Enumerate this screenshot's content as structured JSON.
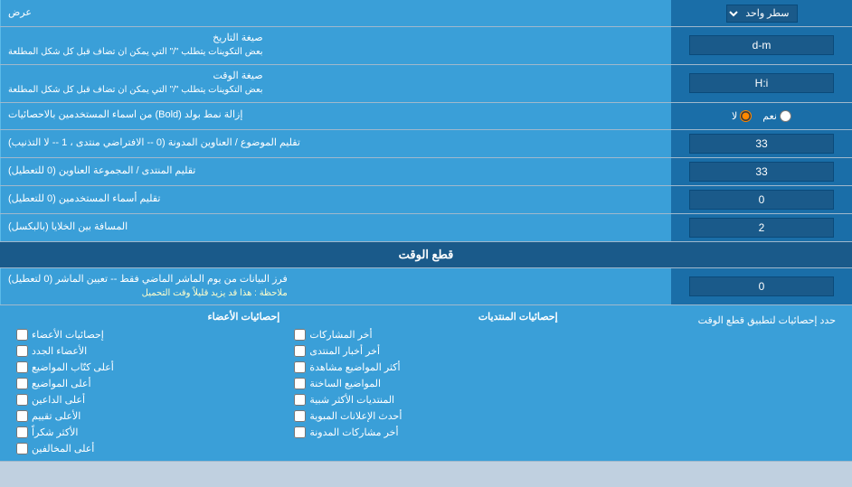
{
  "rows": [
    {
      "id": "عرض",
      "label": "العرض",
      "inputType": "select",
      "value": "سطر واحد"
    },
    {
      "id": "date-format",
      "label": "صيغة التاريخ\nبعض التكوينات يتطلب \"/\" التي يمكن ان تضاف قبل كل شكل المطلعة",
      "inputType": "text",
      "value": "d-m"
    },
    {
      "id": "time-format",
      "label": "صيغة الوقت\nبعض التكوينات يتطلب \"/\" التي يمكن ان تضاف قبل كل شكل المطلعة",
      "inputType": "text",
      "value": "H:i"
    },
    {
      "id": "bold-remove",
      "label": "إزالة نمط بولد (Bold) من اسماء المستخدمين بالاحصائيات",
      "inputType": "radio",
      "options": [
        "نعم",
        "لا"
      ],
      "selectedIndex": 1
    },
    {
      "id": "subject-order",
      "label": "تقليم الموضوع / العناوين المدونة (0 -- الافتراضي منتدى ، 1 -- لا التذنيب)",
      "inputType": "text",
      "value": "33"
    },
    {
      "id": "forum-order",
      "label": "تقليم المنتدى / المجموعة العناوين (0 للتعطيل)",
      "inputType": "text",
      "value": "33"
    },
    {
      "id": "usernames-trim",
      "label": "تقليم أسماء المستخدمين (0 للتعطيل)",
      "inputType": "text",
      "value": "0"
    },
    {
      "id": "cell-spacing",
      "label": "المسافة بين الخلايا (بالبكسل)",
      "inputType": "text",
      "value": "2"
    }
  ],
  "section_cutoff": {
    "title": "قطع الوقت",
    "row": {
      "id": "cutoff-days",
      "label": "فرز البيانات من يوم الماشر الماضي فقط -- تعيين الماشر (0 لتعطيل)\nملاحظة : هذا قد يزيد قليلاً وقت التحميل",
      "inputType": "text",
      "value": "0"
    }
  },
  "stats_settings": {
    "label": "حدد إحصائيات لتطبيق قطع الوقت"
  },
  "checkboxes": {
    "col1_title": "",
    "col2_title": "إحصائيات المنتديات",
    "col3_title": "إحصائيات الأعضاء",
    "col2_items": [
      "أخر المشاركات",
      "أخر أخبار المنتدى",
      "أكثر المواضيع مشاهدة",
      "المواضيع الساخنة",
      "المنتديات الأكثر شبية",
      "أحدث الإعلانات المبوية",
      "أخر مشاركات المدونة"
    ],
    "col3_items": [
      "إحصائيات الأعضاء",
      "الأعضاء الجدد",
      "أعلى كتّاب المواضيع",
      "أعلى المواضيع",
      "أعلى الداعين",
      "الأعلى تقييم",
      "الأكثر شكراً",
      "أعلى المخالفين"
    ]
  }
}
